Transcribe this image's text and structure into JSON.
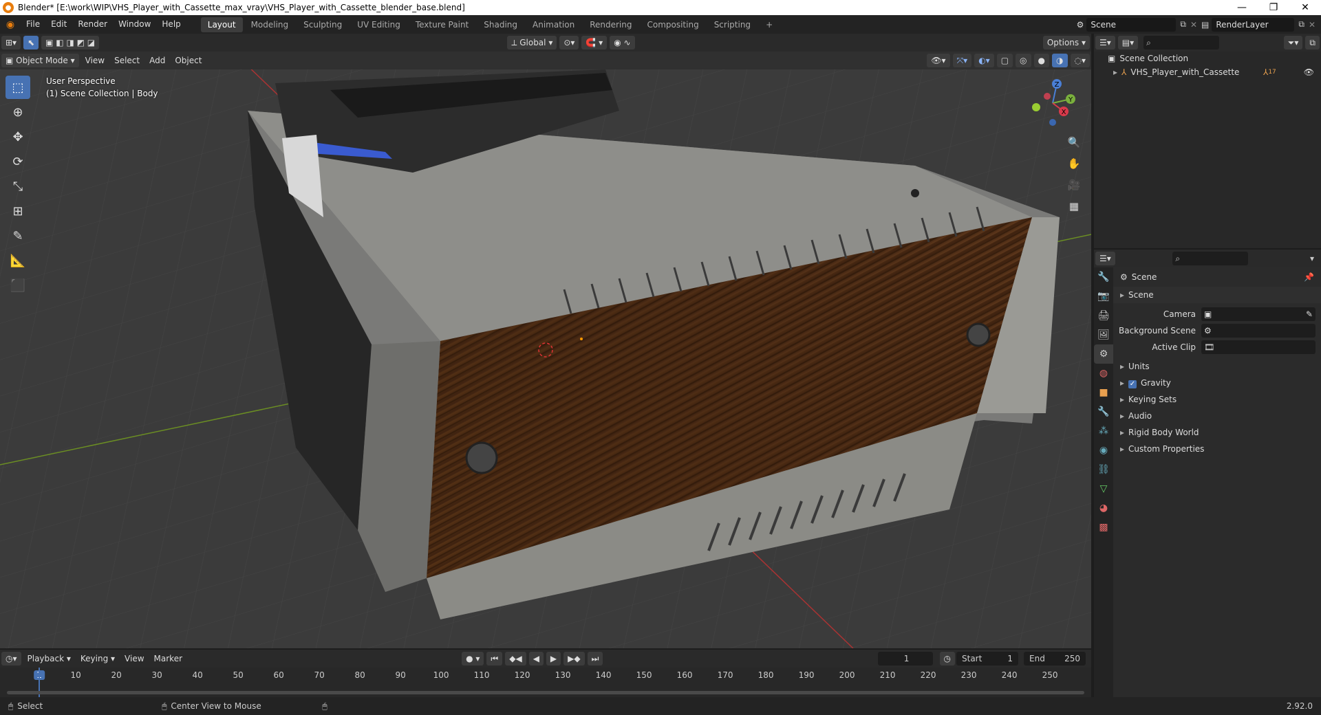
{
  "window": {
    "title": "Blender* [E:\\work\\WIP\\VHS_Player_with_Cassette_max_vray\\VHS_Player_with_Cassette_blender_base.blend]",
    "min_icon": "minimize-icon",
    "max_icon": "maximize-icon",
    "close_icon": "close-icon"
  },
  "menu": [
    "File",
    "Edit",
    "Render",
    "Window",
    "Help"
  ],
  "workspaces": [
    "Layout",
    "Modeling",
    "Sculpting",
    "UV Editing",
    "Texture Paint",
    "Shading",
    "Animation",
    "Rendering",
    "Compositing",
    "Scripting"
  ],
  "active_workspace": "Layout",
  "add_workspace": "+",
  "scene_name": "Scene",
  "render_layer": "RenderLayer",
  "viewport_header": {
    "transform_orientation": "Global",
    "options": "Options",
    "mode": "Object Mode",
    "menus": [
      "View",
      "Select",
      "Add",
      "Object"
    ]
  },
  "viewport_info": {
    "line1": "User Perspective",
    "line2": "(1) Scene Collection | Body"
  },
  "gizmo": {
    "x": "X",
    "y": "Y",
    "z": "Z"
  },
  "outliner": {
    "root": "Scene Collection",
    "items": [
      {
        "label": "VHS_Player_with_Cassette",
        "badge": "17"
      }
    ]
  },
  "properties": {
    "context": "Scene",
    "section": "Scene",
    "fields": [
      {
        "label": "Camera",
        "value": ""
      },
      {
        "label": "Background Scene",
        "value": ""
      },
      {
        "label": "Active Clip",
        "value": ""
      }
    ],
    "panels": [
      "Units",
      "Gravity",
      "Keying Sets",
      "Audio",
      "Rigid Body World",
      "Custom Properties"
    ],
    "gravity_checked": true
  },
  "timeline": {
    "menus": [
      "Playback",
      "Keying",
      "View",
      "Marker"
    ],
    "current_frame": "1",
    "start_label": "Start",
    "start": "1",
    "end_label": "End",
    "end": "250",
    "ticks": [
      "1",
      "10",
      "20",
      "30",
      "40",
      "50",
      "60",
      "70",
      "80",
      "90",
      "100",
      "110",
      "120",
      "130",
      "140",
      "150",
      "160",
      "170",
      "180",
      "190",
      "200",
      "210",
      "220",
      "230",
      "240",
      "250"
    ]
  },
  "status": {
    "left": "Select",
    "middle": "Center View to Mouse",
    "version": "2.92.0"
  }
}
